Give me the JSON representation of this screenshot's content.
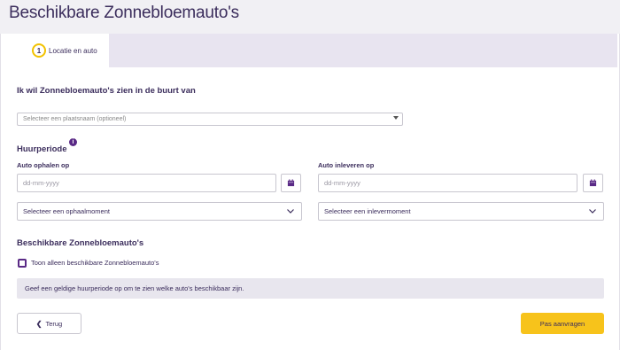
{
  "page": {
    "title": "Beschikbare Zonnebloemauto's"
  },
  "steps": [
    {
      "number": "1",
      "label": "Locatie en auto"
    }
  ],
  "location": {
    "heading": "Ik wil Zonnebloemauto's zien in de buurt van",
    "placeholder": "Selecteer een plaatsnaam (optioneel)"
  },
  "rental": {
    "heading": "Huurperiode",
    "info_icon": "info-icon",
    "pickup": {
      "label": "Auto ophalen op",
      "date_placeholder": "dd-mm-yyyy",
      "moment_placeholder": "Selecteer een ophaalmoment"
    },
    "return": {
      "label": "Auto inleveren op",
      "date_placeholder": "dd-mm-yyyy",
      "moment_placeholder": "Selecteer een inlevermoment"
    }
  },
  "available": {
    "heading": "Beschikbare Zonnebloemauto's",
    "only_available_label": "Toon alleen beschikbare Zonnebloemauto's",
    "only_available_checked": false,
    "notice": "Geef een geldige huurperiode op om te zien welke auto's beschikbaar zijn."
  },
  "actions": {
    "back_label": "Terug",
    "submit_label": "Pas aanvragen"
  },
  "colors": {
    "primary": "#3b2d5c",
    "accent": "#f7c31b",
    "purple": "#5a2a86",
    "tab_inactive": "#e8e4f0"
  }
}
